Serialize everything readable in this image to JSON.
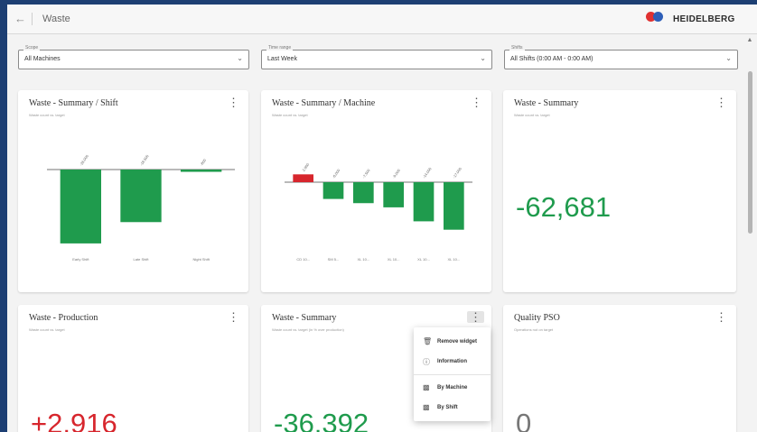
{
  "header": {
    "back_icon": "arrow-left-icon",
    "title": "Waste",
    "brand": "HEIDELBERG"
  },
  "filters": [
    {
      "label": "Scope",
      "value": "All Machines"
    },
    {
      "label": "Time range",
      "value": "Last Week"
    },
    {
      "label": "Shifts",
      "value": "All Shifts (0:00 AM - 0:00 AM)"
    }
  ],
  "cards": {
    "shift": {
      "title": "Waste - Summary / Shift",
      "subtitle": "Waste count vs. target"
    },
    "machine": {
      "title": "Waste - Summary / Machine",
      "subtitle": "Waste count vs. target"
    },
    "summary": {
      "title": "Waste - Summary",
      "subtitle": "Waste count vs. target",
      "value": "-62,681"
    },
    "production": {
      "title": "Waste - Production",
      "subtitle": "Waste count vs. target",
      "value": "+2,916"
    },
    "summary2": {
      "title": "Waste - Summary",
      "subtitle": "Waste count vs. target (in % over production)",
      "value": "-36,392"
    },
    "quality": {
      "title": "Quality PSO",
      "subtitle": "Operations not on target",
      "value": "0"
    }
  },
  "context_menu": {
    "items": [
      {
        "icon": "trash-icon",
        "label": "Remove widget"
      },
      {
        "icon": "info-icon",
        "label": "Information"
      },
      {
        "icon": "bar-chart-icon",
        "label": "By Machine"
      },
      {
        "icon": "bar-chart-icon",
        "label": "By Shift"
      }
    ]
  },
  "colors": {
    "negative": "#1f9b4d",
    "positive": "#d7262d",
    "accent": "#1d3f73"
  },
  "chart_data": [
    {
      "type": "bar",
      "title": "Waste - Summary / Shift",
      "categories": [
        "Early Shift",
        "Late Shift",
        "Night Shift"
      ],
      "values": [
        -26000,
        -18500,
        -800
      ],
      "data_labels": [
        "-26,000",
        "-18,500",
        "-800"
      ]
    },
    {
      "type": "bar",
      "title": "Waste - Summary / Machine",
      "categories": [
        "CD 10...",
        "SM 5...",
        "XL 10...",
        "XL 10...",
        "XL 10...",
        "XL 10..."
      ],
      "values": [
        2800,
        -6000,
        -7500,
        -9000,
        -14000,
        -17000
      ],
      "data_labels": [
        "2,800",
        "-6,000",
        "-7,500",
        "-9,000",
        "-14,000",
        "-17,000"
      ]
    }
  ]
}
